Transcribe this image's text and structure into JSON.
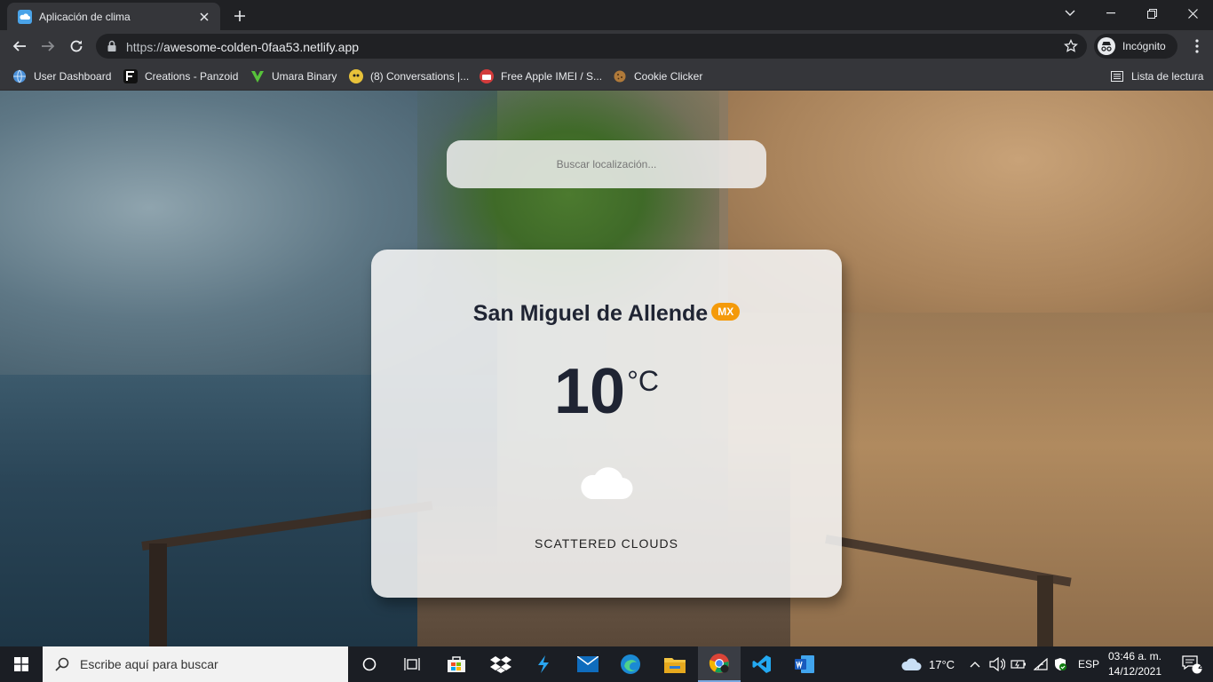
{
  "browser": {
    "tab": {
      "title": "Aplicación de clima",
      "favicon": "weather-cloud-icon"
    },
    "url": {
      "scheme": "https://",
      "host": "awesome-colden-0faa53.netlify.app"
    },
    "profile_label": "Incógnito",
    "bookmarks": [
      {
        "label": "User Dashboard",
        "icon": "globe-icon",
        "color": "#4a90d9"
      },
      {
        "label": "Creations - Panzoid",
        "icon": "panzoid-icon",
        "color": "#111111"
      },
      {
        "label": "Umara Binary",
        "icon": "umara-icon",
        "color": "#57c23a"
      },
      {
        "label": "(8) Conversations |...",
        "icon": "conversations-icon",
        "color": "#e8c23a"
      },
      {
        "label": "Free Apple IMEI / S...",
        "icon": "imei-icon",
        "color": "#d33b3b"
      },
      {
        "label": "Cookie Clicker",
        "icon": "cookie-icon",
        "color": "#b07a3a"
      }
    ],
    "reading_list_label": "Lista de lectura"
  },
  "search": {
    "placeholder": "Buscar localización..."
  },
  "weather": {
    "city": "San Miguel de Allende",
    "country": "MX",
    "temperature": "10",
    "unit": "°C",
    "icon": "cloud-icon",
    "description": "SCATTERED CLOUDS"
  },
  "taskbar": {
    "search_placeholder": "Escribe aquí para buscar",
    "weather_temp": "17°C",
    "language": "ESP",
    "time": "03:46 a. m.",
    "date": "14/12/2021",
    "notification_count": "2"
  },
  "colors": {
    "accent_badge": "#f49a0a",
    "text_dark": "#1f2433"
  }
}
